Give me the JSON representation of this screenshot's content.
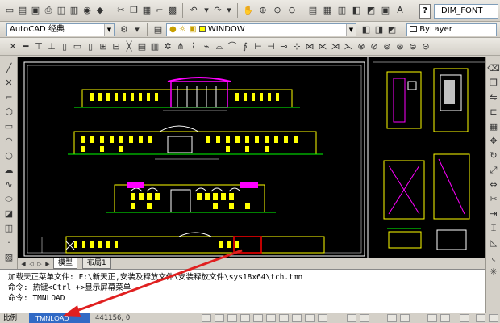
{
  "toolbar": {
    "help_glyph": "?",
    "dim_font": "DIM_FONT",
    "workspace": "AutoCAD 经典",
    "layer": "WINDOW",
    "linetype": "ByLayer"
  },
  "tabs": [
    "模型",
    "布局1"
  ],
  "command": {
    "line1": "加载天正菜单文件: F:\\新天正,安装及释放文件\\安装释放文件\\sys18x64\\tch.tmn",
    "line2": "命令: 热键<Ctrl +>显示屏幕菜单",
    "line3": "命令: TMNLOAD"
  },
  "status": {
    "left_label": "比例",
    "highlight": "TMNLOAD",
    "coords": "441156, 0"
  },
  "colors": {
    "accent": "#316ac5",
    "arrow": "#e02020"
  }
}
